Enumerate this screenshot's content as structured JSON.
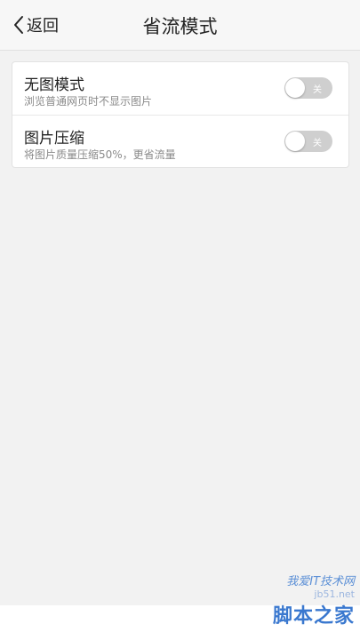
{
  "header": {
    "back_label": "返回",
    "title": "省流模式"
  },
  "settings": [
    {
      "title": "无图模式",
      "subtitle": "浏览普通网页时不显示图片",
      "toggle_text": "关"
    },
    {
      "title": "图片压缩",
      "subtitle": "将图片质量压缩50%，更省流量",
      "toggle_text": "关"
    }
  ],
  "watermark": {
    "line1": "我爱IT技术网",
    "url": "jb51.net",
    "line2": "脚本之家"
  },
  "colors": {
    "toggle_off": "#cfcfcf",
    "watermark_blue": "#3a78cf"
  },
  "icons": {
    "back": "chevron-left-icon"
  }
}
